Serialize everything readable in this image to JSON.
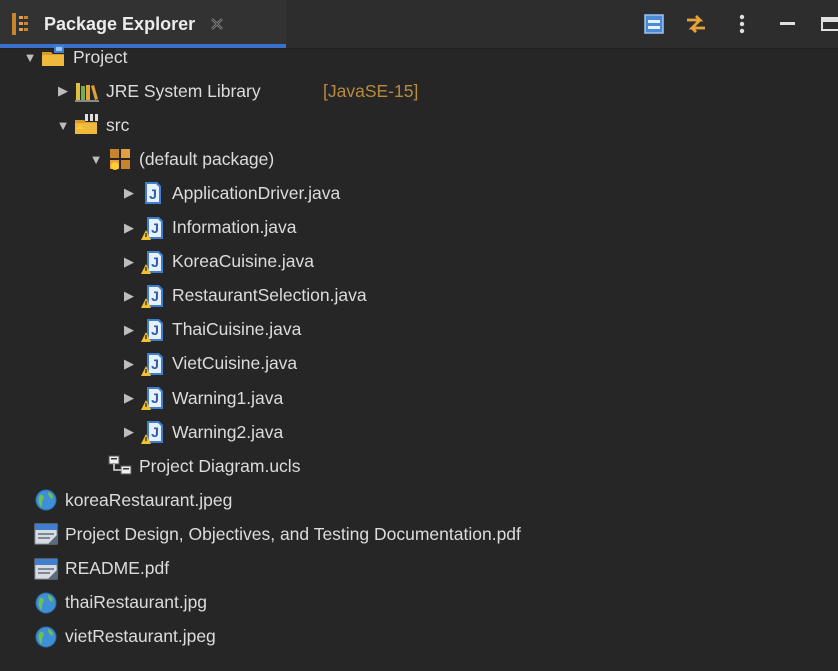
{
  "view": {
    "title": "Package Explorer",
    "toolbar": [
      {
        "name": "collapse-all-button",
        "icon": "collapse-all-icon"
      },
      {
        "name": "link-with-editor-button",
        "icon": "link-with-editor-icon"
      },
      {
        "name": "view-menu-button",
        "icon": "more-vertical-icon"
      },
      {
        "name": "minimize-button",
        "icon": "minimize-icon"
      },
      {
        "name": "maximize-button",
        "icon": "maximize-icon"
      }
    ]
  },
  "tree": [
    {
      "label": "Project",
      "decoration": "",
      "depth": 0,
      "expander": "expanded",
      "icon": "project-folder-icon"
    },
    {
      "label": "JRE System Library",
      "decoration": "[JavaSE-15]",
      "depth": 1,
      "expander": "collapsed",
      "icon": "library-icon"
    },
    {
      "label": "src",
      "decoration": "",
      "depth": 1,
      "expander": "expanded",
      "icon": "source-folder-icon"
    },
    {
      "label": "(default package)",
      "decoration": "",
      "depth": 2,
      "expander": "expanded",
      "icon": "package-icon"
    },
    {
      "label": "ApplicationDriver.java",
      "decoration": "",
      "depth": 3,
      "expander": "collapsed",
      "icon": "java-file-icon"
    },
    {
      "label": "Information.java",
      "decoration": "",
      "depth": 3,
      "expander": "collapsed",
      "icon": "java-file-warning-icon"
    },
    {
      "label": "KoreaCuisine.java",
      "decoration": "",
      "depth": 3,
      "expander": "collapsed",
      "icon": "java-file-warning-icon"
    },
    {
      "label": "RestaurantSelection.java",
      "decoration": "",
      "depth": 3,
      "expander": "collapsed",
      "icon": "java-file-warning-icon"
    },
    {
      "label": "ThaiCuisine.java",
      "decoration": "",
      "depth": 3,
      "expander": "collapsed",
      "icon": "java-file-warning-icon"
    },
    {
      "label": "VietCuisine.java",
      "decoration": "",
      "depth": 3,
      "expander": "collapsed",
      "icon": "java-file-warning-icon"
    },
    {
      "label": "Warning1.java",
      "decoration": "",
      "depth": 3,
      "expander": "collapsed",
      "icon": "java-file-warning-icon"
    },
    {
      "label": "Warning2.java",
      "decoration": "",
      "depth": 3,
      "expander": "collapsed",
      "icon": "java-file-warning-icon"
    },
    {
      "label": "Project Diagram.ucls",
      "decoration": "",
      "depth": 2,
      "expander": "none",
      "icon": "diagram-icon"
    },
    {
      "label": "koreaRestaurant.jpeg",
      "decoration": "",
      "depth": 1,
      "expander": "none",
      "icon": "globe-icon"
    },
    {
      "label": "Project Design, Objectives, and Testing Documentation.pdf",
      "decoration": "",
      "depth": 1,
      "expander": "none",
      "icon": "pdf-file-icon"
    },
    {
      "label": "README.pdf",
      "decoration": "",
      "depth": 1,
      "expander": "none",
      "icon": "pdf-file-icon"
    },
    {
      "label": "thaiRestaurant.jpg",
      "decoration": "",
      "depth": 1,
      "expander": "none",
      "icon": "globe-icon"
    },
    {
      "label": "vietRestaurant.jpeg",
      "decoration": "",
      "depth": 1,
      "expander": "none",
      "icon": "globe-icon"
    }
  ],
  "colors": {
    "background": "#262626",
    "tab_background": "#323233",
    "tab_underline": "#3b71ca",
    "text": "#dcdcdc",
    "decoration_text": "#b88a3e"
  }
}
